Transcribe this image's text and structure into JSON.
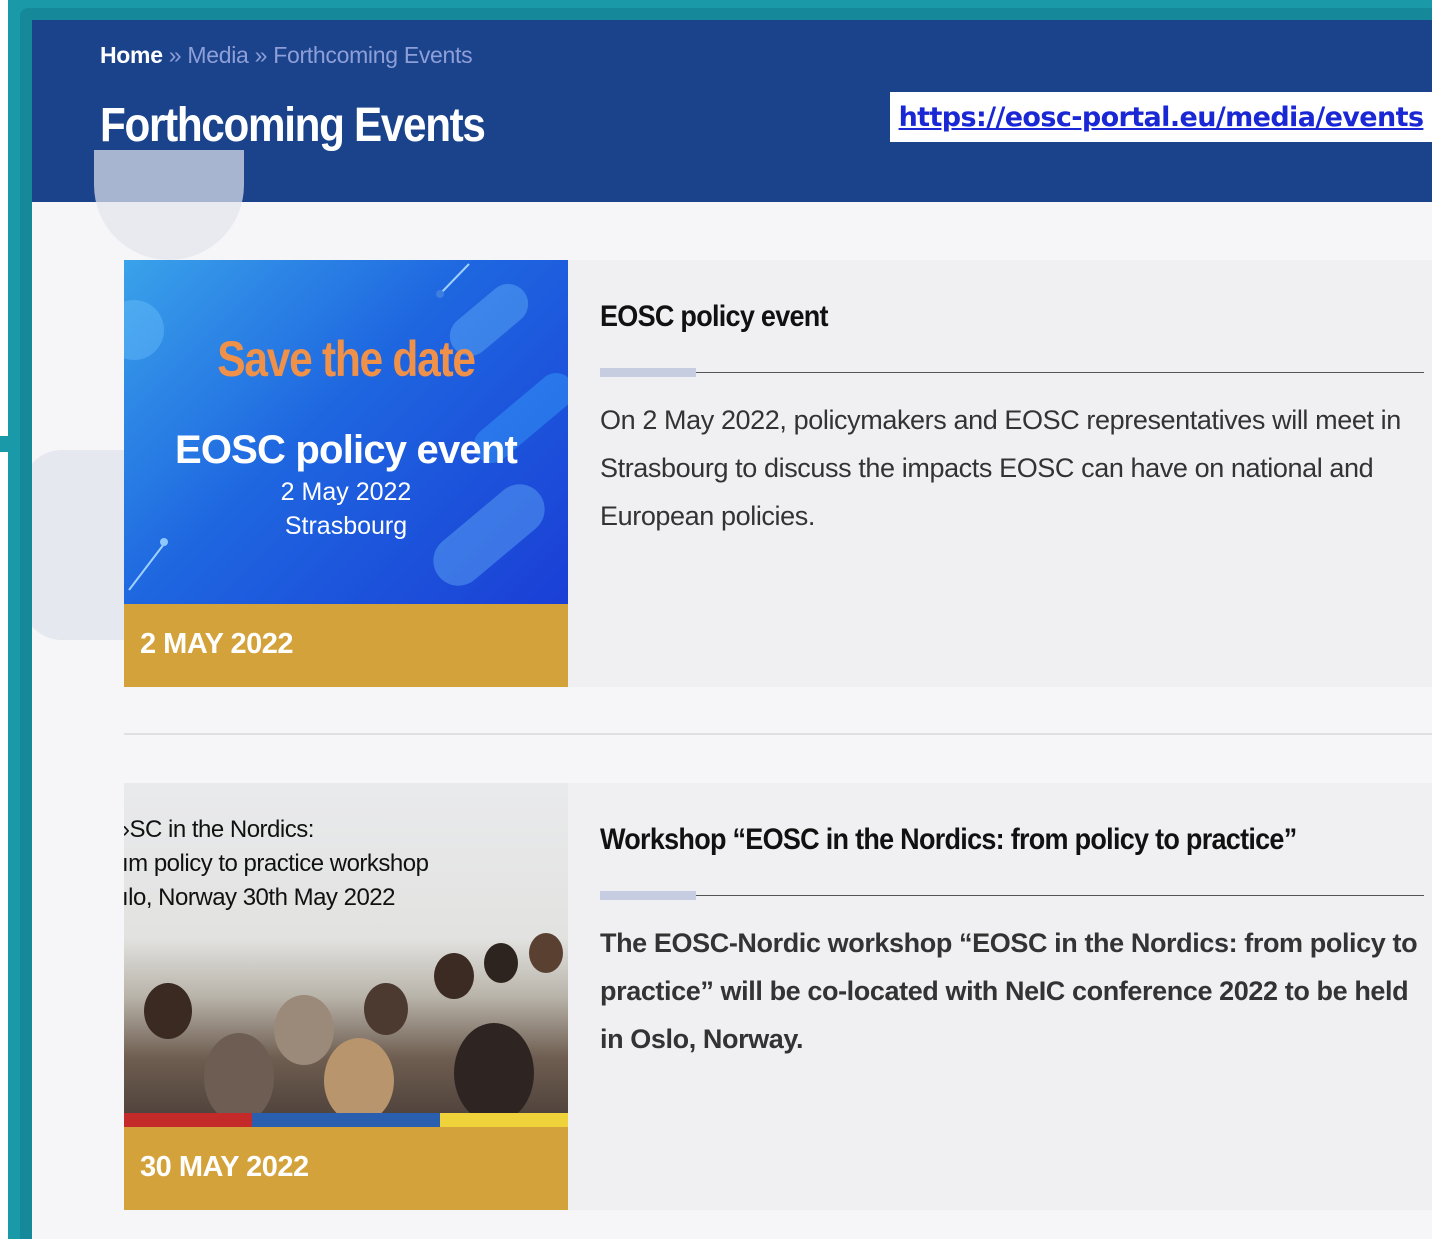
{
  "breadcrumb": {
    "home": "Home",
    "sep1": " » ",
    "media": "Media",
    "sep2": " » ",
    "current": "Forthcoming Events"
  },
  "page_title": "Forthcoming Events",
  "url_label": "https://eosc-portal.eu/media/events",
  "events": [
    {
      "image": {
        "save_the_date": "Save the date",
        "event_name": "EOSC policy event",
        "date": "2 May 2022",
        "city": "Strasbourg"
      },
      "date_badge": "2 MAY 2022",
      "title": "EOSC policy event",
      "description": "On 2 May 2022, policymakers and EOSC representatives will meet in Strasbourg to discuss the impacts EOSC can have on national and European policies."
    },
    {
      "image": {
        "line1": "›SC in the Nordics:",
        "line2": "ım policy to practice workshop",
        "line3": "ılo, Norway 30th May 2022"
      },
      "date_badge": "30 MAY 2022",
      "title": "Workshop “EOSC in the Nordics: from policy to practice”",
      "description": "The EOSC-Nordic workshop “EOSC in the Nordics: from policy to practice” will be co-located with NeIC conference 2022 to be held in Oslo, Norway."
    }
  ],
  "colors": {
    "header_bg": "#1b438c",
    "date_badge_bg": "#d4a23a",
    "frame": "#15899a",
    "url_link": "#1a27d4"
  }
}
